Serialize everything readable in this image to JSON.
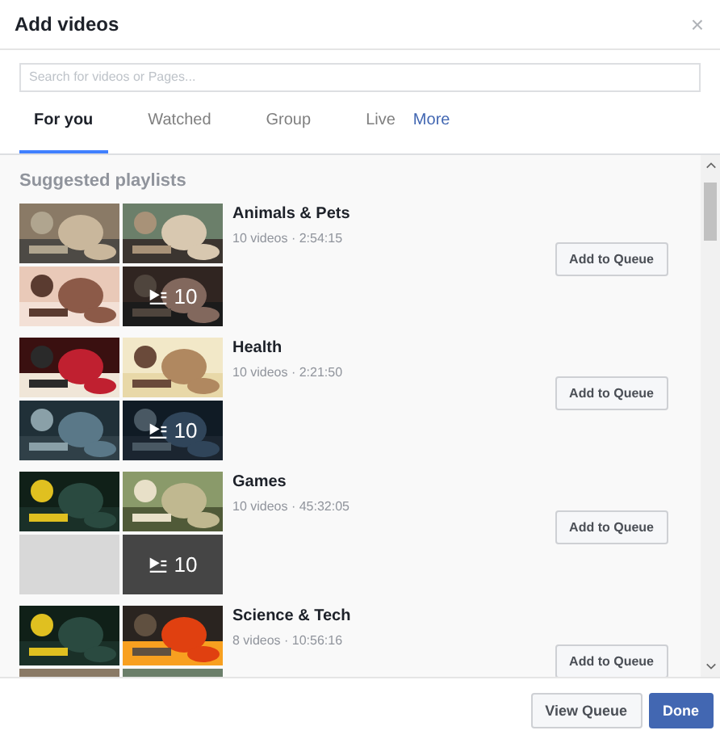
{
  "dialog": {
    "title": "Add videos",
    "close": "×"
  },
  "search": {
    "placeholder": "Search for videos or Pages..."
  },
  "tabs": [
    {
      "label": "For you",
      "selected": true
    },
    {
      "label": "Watched",
      "selected": false
    },
    {
      "label": "Group",
      "selected": false
    },
    {
      "label": "Live",
      "selected": false
    },
    {
      "label": "More",
      "selected": false,
      "kind": "link"
    }
  ],
  "section_title": "Suggested playlists",
  "playlists": [
    {
      "title": "Animals & Pets",
      "meta": "10 videos · 2:54:15",
      "count": "10",
      "cells": [
        {
          "kind": "picture"
        },
        {
          "kind": "picture"
        },
        {
          "kind": "picture"
        },
        {
          "kind": "picture"
        }
      ],
      "button": "Add to Queue"
    },
    {
      "title": "Health",
      "meta": "10 videos · 2:21:50",
      "count": "10",
      "cells": [
        {
          "kind": "picture"
        },
        {
          "kind": "picture"
        },
        {
          "kind": "picture"
        },
        {
          "kind": "picture"
        }
      ],
      "button": "Add to Queue"
    },
    {
      "title": "Games",
      "meta": "10 videos · 45:32:05",
      "count": "10",
      "cells": [
        {
          "kind": "picture"
        },
        {
          "kind": "picture"
        },
        {
          "kind": "blank"
        },
        {
          "kind": "blank"
        }
      ],
      "button": "Add to Queue"
    },
    {
      "title": "Science & Tech",
      "meta": "8 videos · 10:56:16",
      "cells": [
        {
          "kind": "picture"
        },
        {
          "kind": "picture"
        },
        {
          "kind": "picture"
        },
        {
          "kind": "picture"
        }
      ],
      "button": "Add to Queue"
    }
  ],
  "footer_buttons": [
    {
      "label": "View Queue",
      "kind": "secondary"
    },
    {
      "label": "Done",
      "kind": "primary"
    }
  ]
}
